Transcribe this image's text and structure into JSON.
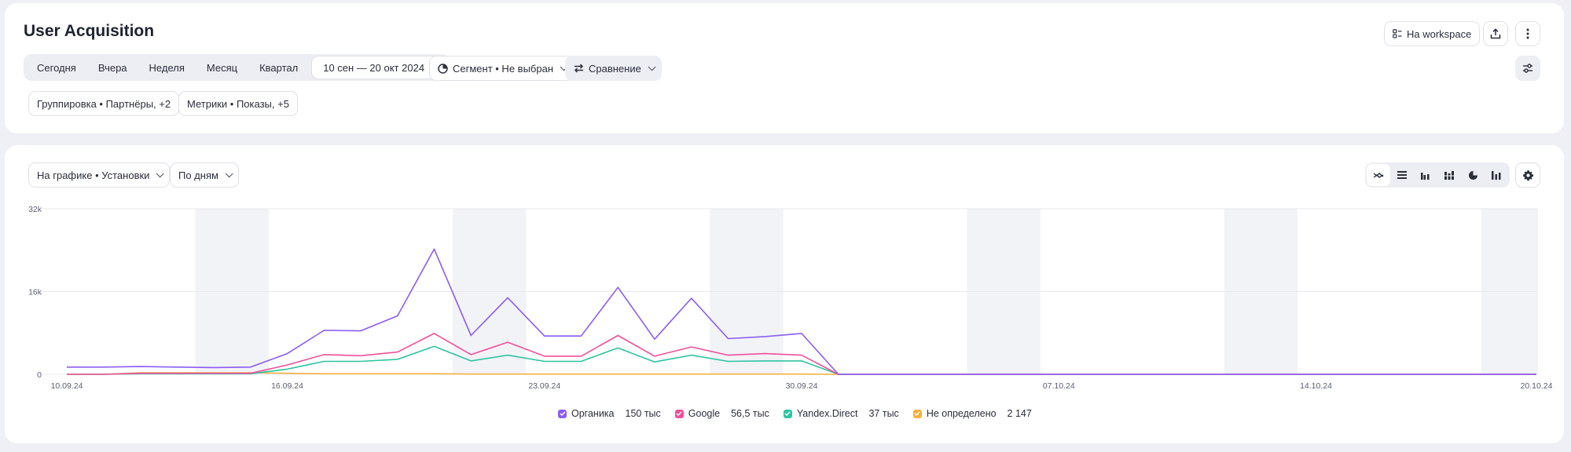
{
  "page": {
    "title": "User Acquisition"
  },
  "header": {
    "workspace_label": "На workspace",
    "export_icon": "upload-icon",
    "more_icon": "more-vertical-icon"
  },
  "period": {
    "items": [
      "Сегодня",
      "Вчера",
      "Неделя",
      "Месяц",
      "Квартал"
    ],
    "date_range": "10 сен — 20 окт 2024"
  },
  "segment_label": "Сегмент • Не выбран",
  "comparison_label": "Сравнение",
  "grouping_label": "Группировка • Партнёры, +2",
  "metrics_label": "Метрики • Показы, +5",
  "chart_controls": {
    "graph_metric": "На графике • Установки",
    "interval": "По дням"
  },
  "colors": {
    "organic": "#8b5cf6",
    "google": "#f0509a",
    "yandex_direct": "#2ec4a0",
    "undefined": "#f5b040",
    "weekend_band": "#f2f3f7",
    "grid": "#e8e9ee"
  },
  "chart_data": {
    "type": "line",
    "x": [
      "10.09.24",
      "11.09.24",
      "12.09.24",
      "13.09.24",
      "14.09.24",
      "15.09.24",
      "16.09.24",
      "17.09.24",
      "18.09.24",
      "19.09.24",
      "20.09.24",
      "21.09.24",
      "22.09.24",
      "23.09.24",
      "24.09.24",
      "25.09.24",
      "26.09.24",
      "27.09.24",
      "28.09.24",
      "29.09.24",
      "30.09.24",
      "01.10.24",
      "02.10.24",
      "03.10.24",
      "04.10.24",
      "05.10.24",
      "06.10.24",
      "07.10.24",
      "08.10.24",
      "09.10.24",
      "10.10.24",
      "11.10.24",
      "12.10.24",
      "13.10.24",
      "14.10.24",
      "15.10.24",
      "16.10.24",
      "17.10.24",
      "18.10.24",
      "19.10.24",
      "20.10.24"
    ],
    "x_tick_labels": [
      "10.09.24",
      "16.09.24",
      "23.09.24",
      "30.09.24",
      "07.10.24",
      "14.10.24",
      "20.10.24"
    ],
    "y_ticks": [
      "0",
      "16k",
      "32k"
    ],
    "ylim": [
      0,
      32000
    ],
    "weekend_dates": [
      [
        "14.09.24",
        "15.09.24"
      ],
      [
        "21.09.24",
        "22.09.24"
      ],
      [
        "28.09.24",
        "29.09.24"
      ],
      [
        "05.10.24",
        "06.10.24"
      ],
      [
        "12.10.24",
        "13.10.24"
      ],
      [
        "19.10.24",
        "20.10.24"
      ]
    ],
    "series": [
      {
        "name": "Органика",
        "total": "150 тыс",
        "color_key": "organic",
        "values": [
          1400,
          1400,
          1500,
          1400,
          1300,
          1400,
          4000,
          8500,
          8400,
          11300,
          24200,
          7500,
          14800,
          7400,
          7400,
          16800,
          6800,
          14700,
          6900,
          7300,
          7900,
          0,
          0,
          0,
          0,
          0,
          0,
          0,
          0,
          0,
          0,
          0,
          0,
          0,
          0,
          0,
          0,
          0,
          0,
          0,
          0
        ]
      },
      {
        "name": "Google",
        "total": "56,5 тыс",
        "color_key": "google",
        "values": [
          0,
          0,
          200,
          200,
          200,
          200,
          1800,
          3800,
          3600,
          4300,
          7900,
          3800,
          6200,
          3500,
          3500,
          7500,
          3500,
          5300,
          3700,
          4000,
          3700,
          0,
          0,
          0,
          0,
          0,
          0,
          0,
          0,
          0,
          0,
          0,
          0,
          0,
          0,
          0,
          0,
          0,
          0,
          0,
          0
        ]
      },
      {
        "name": "Yandex.Direct",
        "total": "37 тыс",
        "color_key": "yandex_direct",
        "values": [
          0,
          0,
          100,
          100,
          100,
          100,
          1000,
          2500,
          2500,
          2900,
          5400,
          2600,
          3700,
          2500,
          2500,
          5100,
          2400,
          3700,
          2500,
          2600,
          2600,
          0,
          0,
          0,
          0,
          0,
          0,
          0,
          0,
          0,
          0,
          0,
          0,
          0,
          0,
          0,
          0,
          0,
          0,
          0,
          0
        ]
      },
      {
        "name": "Не определено",
        "total": "2 147",
        "color_key": "undefined",
        "values": [
          0,
          0,
          300,
          300,
          300,
          300,
          200,
          100,
          100,
          100,
          100,
          50,
          50,
          50,
          50,
          50,
          50,
          50,
          50,
          50,
          50,
          0,
          0,
          0,
          0,
          0,
          0,
          0,
          0,
          0,
          0,
          0,
          0,
          0,
          0,
          0,
          0,
          0,
          0,
          0,
          0
        ]
      }
    ]
  }
}
